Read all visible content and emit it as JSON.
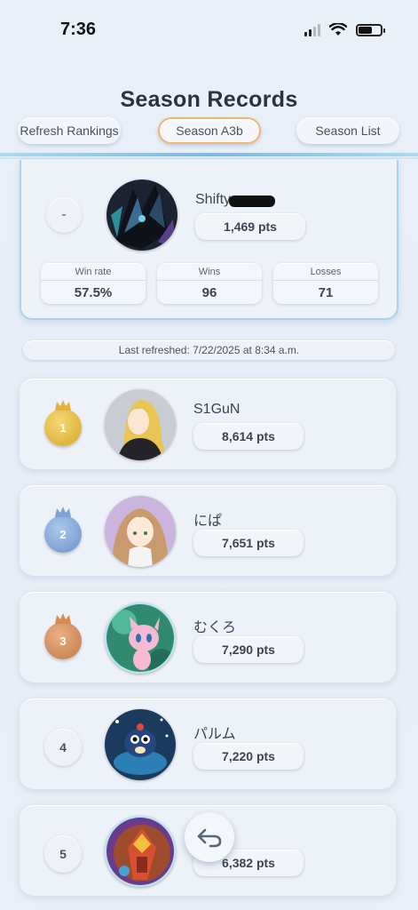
{
  "status_bar": {
    "time": "7:36"
  },
  "header": {
    "title": "Season Records",
    "tabs": [
      "Refresh Rankings",
      "Season A3b",
      "Season List"
    ]
  },
  "my_record": {
    "rank": "-",
    "name": "Shifty",
    "points": "1,469 pts",
    "stats": [
      {
        "label": "Win rate",
        "value": "57.5%"
      },
      {
        "label": "Wins",
        "value": "96"
      },
      {
        "label": "Losses",
        "value": "71"
      }
    ]
  },
  "last_refreshed": "Last refreshed: 7/22/2025 at 8:34 a.m.",
  "rankings": [
    {
      "rank": "1",
      "name": "S1GuN",
      "points": "8,614 pts",
      "medal": "gold"
    },
    {
      "rank": "2",
      "name": "にぱ",
      "points": "7,651 pts",
      "medal": "silver"
    },
    {
      "rank": "3",
      "name": "むくろ",
      "points": "7,290 pts",
      "medal": "bronze"
    },
    {
      "rank": "4",
      "name": "パルム",
      "points": "7,220 pts",
      "medal": "none"
    },
    {
      "rank": "5",
      "name": "",
      "points": "6,382 pts",
      "medal": "none"
    }
  ],
  "colors": {
    "accent_tab_border": "#f0b774",
    "header_line": "#6fb6d8",
    "gold": "#d6a928",
    "silver": "#6c92c9",
    "bronze": "#c17945"
  }
}
